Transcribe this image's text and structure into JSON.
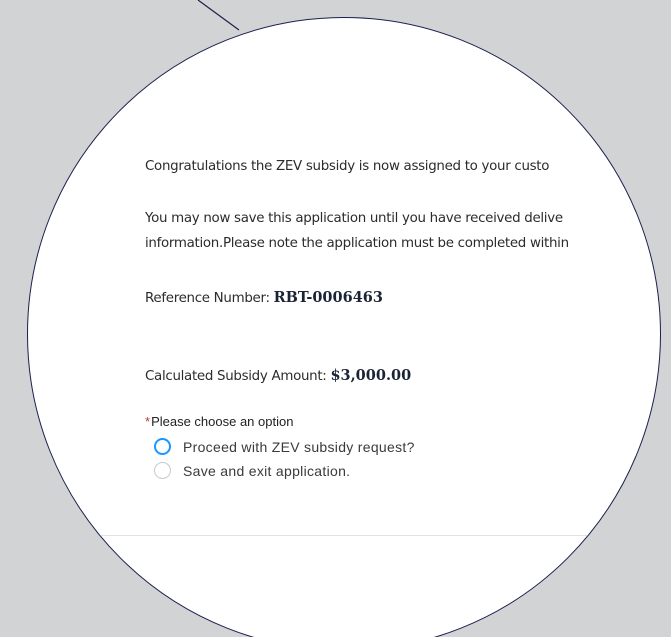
{
  "message": {
    "congrats": "Congratulations the ZEV subsidy is now assigned to your custo",
    "save_line1": "You may now save this application until you have received delive",
    "save_line2": "information.Please note the application must be completed within"
  },
  "reference": {
    "label": "Reference Number: ",
    "value": "RBT-0006463"
  },
  "subsidy": {
    "label": "Calculated Subsidy Amount: ",
    "value": "$3,000.00"
  },
  "options": {
    "required_marker": "*",
    "prompt": "Please choose an option",
    "items": [
      {
        "label": "Proceed with ZEV subsidy request?",
        "focused": true
      },
      {
        "label": "Save and exit application.",
        "focused": false
      }
    ]
  },
  "colors": {
    "backdrop": "#d2d3d5",
    "lens_border": "#1c1f4e",
    "focus_ring": "#1b96ff",
    "required": "#c23934"
  }
}
